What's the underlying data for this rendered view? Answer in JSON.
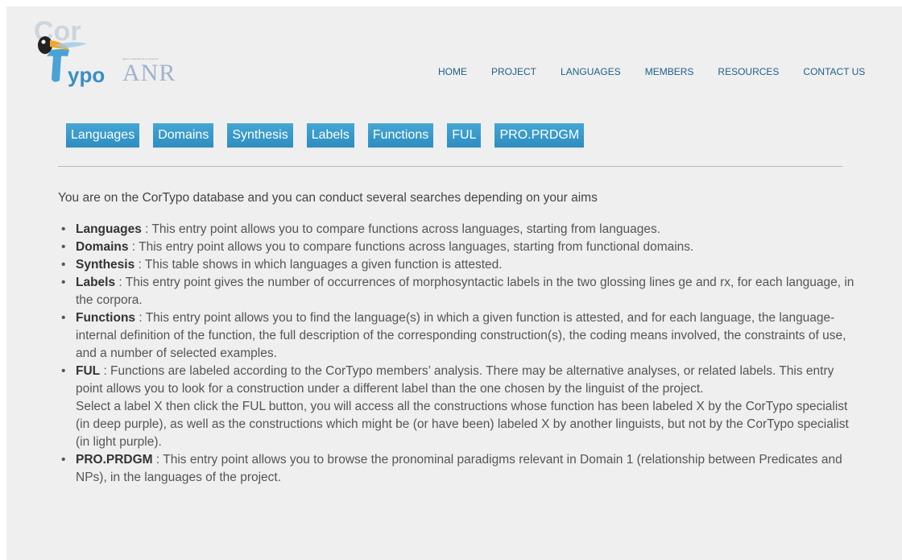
{
  "header": {
    "logo_text_top": "Cor",
    "logo_text_bottom": "ypo",
    "anr_text": "ANR"
  },
  "nav": [
    {
      "label": "HOME"
    },
    {
      "label": "PROJECT"
    },
    {
      "label": "LANGUAGES"
    },
    {
      "label": "MEMBERS"
    },
    {
      "label": "RESOURCES"
    },
    {
      "label": "CONTACT US"
    }
  ],
  "tabs": [
    {
      "label": "Languages"
    },
    {
      "label": "Domains"
    },
    {
      "label": "Synthesis"
    },
    {
      "label": "Labels"
    },
    {
      "label": "Functions"
    },
    {
      "label": "FUL"
    },
    {
      "label": "PRO.PRDGM"
    }
  ],
  "intro": "You are on the CorTypo database and you can conduct several searches depending on your aims",
  "items": [
    {
      "term": "Languages",
      "text": " : This entry point allows you to compare functions across languages, starting from languages."
    },
    {
      "term": "Domains",
      "text": " : This entry point allows you to compare functions across languages, starting from functional domains."
    },
    {
      "term": "Synthesis",
      "text": " : This table shows in which languages a given function is attested."
    },
    {
      "term": "Labels",
      "text": " : This entry point gives the number of occurrences of morphosyntactic labels in the two glossing lines ge and rx, for each language, in the corpora."
    },
    {
      "term": "Functions",
      "text": " : This entry point allows you to find the language(s) in which a given function is attested, and for each language, the language-internal definition of the function, the full description of the corresponding construction(s), the coding means involved, the constraints of use, and a number of selected examples."
    },
    {
      "term": "FUL",
      "text": " : Functions are labeled according to the CorTypo members’ analysis. There may be alternative analyses, or related labels. This entry point allows you to look for a construction under a different label than the one chosen by the linguist of the project.",
      "extra": "Select a label X then click the FUL button, you will access all the constructions whose function has been labeled X by the CorTypo specialist (in deep purple), as well as the constructions which might be (or have been) labeled X by another linguists, but not by the CorTypo specialist (in light purple)."
    },
    {
      "term": "PRO.PRDGM",
      "text": " : This entry point allows you to browse the pronominal paradigms relevant in Domain 1 (relationship between Predicates and NPs), in the languages of the project."
    }
  ]
}
